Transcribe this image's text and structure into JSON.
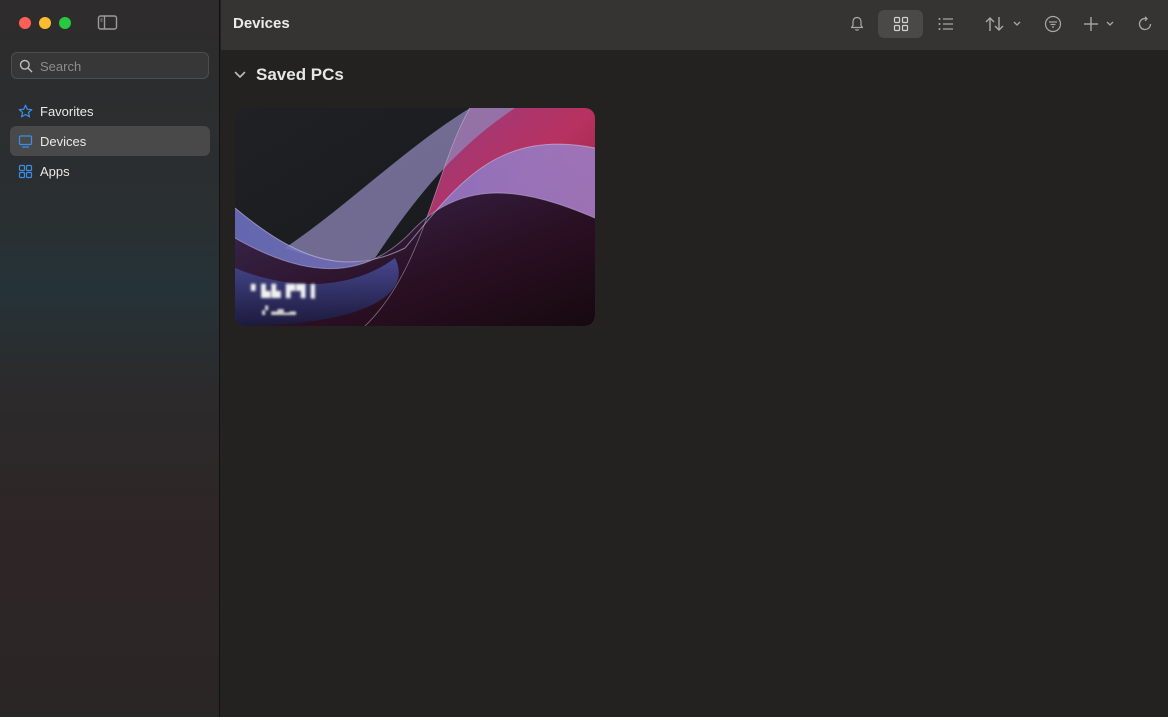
{
  "window": {
    "title": "Devices"
  },
  "sidebar": {
    "search_placeholder": "Search",
    "items": [
      {
        "label": "Favorites",
        "icon": "star-icon",
        "selected": false
      },
      {
        "label": "Devices",
        "icon": "monitor-icon",
        "selected": true
      },
      {
        "label": "Apps",
        "icon": "apps-grid-icon",
        "selected": false
      }
    ]
  },
  "toolbar": {
    "icons": [
      "bell-icon",
      "grid-view-icon",
      "list-view-icon",
      "sort-icon",
      "filter-icon",
      "add-icon",
      "refresh-icon"
    ],
    "active_view": "grid"
  },
  "main": {
    "section_title": "Saved PCs",
    "devices": [
      {
        "name": "▘▙▙ ▛▜ ▌",
        "subtitle": "▗▘▃▅▂▃"
      }
    ]
  },
  "colors": {
    "accent": "#3b8ee8",
    "close": "#ff5f57",
    "minimize": "#febc2e",
    "zoom": "#28c840"
  }
}
